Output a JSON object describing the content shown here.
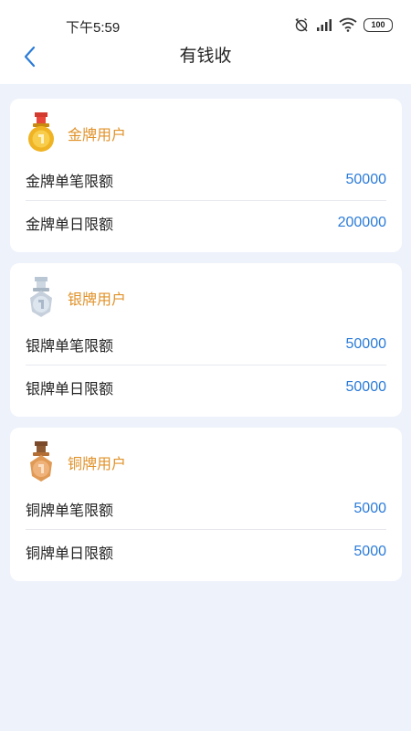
{
  "status_bar": {
    "time": "下午5:59",
    "battery": "100"
  },
  "header": {
    "title": "有钱收"
  },
  "tiers": [
    {
      "label": "金牌用户",
      "medal_color": "#f0b323",
      "single_limit_label": "金牌单笔限额",
      "single_limit_value": "50000",
      "daily_limit_label": "金牌单日限额",
      "daily_limit_value": "200000"
    },
    {
      "label": "银牌用户",
      "medal_color": "#c5d0dc",
      "single_limit_label": "银牌单笔限额",
      "single_limit_value": "50000",
      "daily_limit_label": "银牌单日限额",
      "daily_limit_value": "50000"
    },
    {
      "label": "铜牌用户",
      "medal_color": "#e09a55",
      "single_limit_label": "铜牌单笔限额",
      "single_limit_value": "5000",
      "daily_limit_label": "铜牌单日限额",
      "daily_limit_value": "5000"
    }
  ],
  "colors": {
    "accent_blue": "#2b7bd9",
    "tier_label_orange": "#e0922a",
    "page_background": "#eef2fb"
  }
}
